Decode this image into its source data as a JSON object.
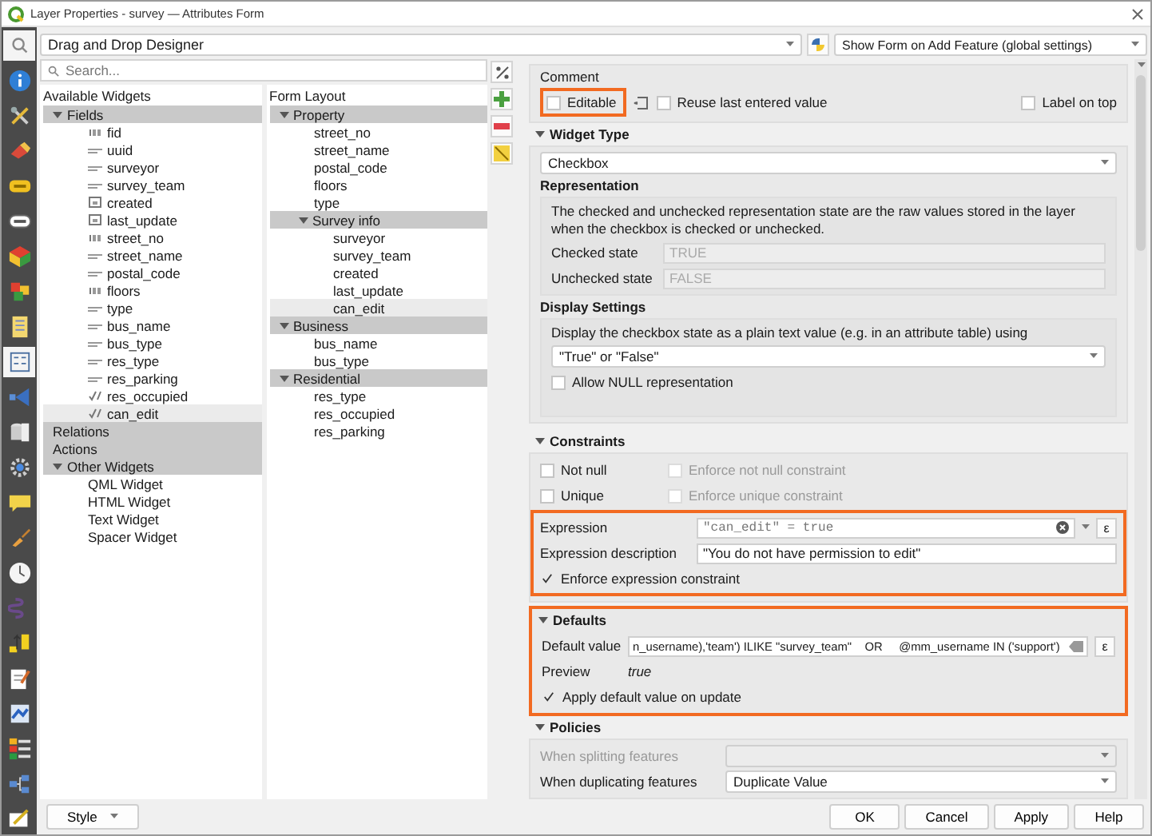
{
  "window": {
    "title": "Layer Properties - survey — Attributes Form"
  },
  "sidebar": {
    "items": [
      {
        "kind": "info",
        "selected": false
      },
      {
        "kind": "tools",
        "selected": false
      },
      {
        "kind": "paint",
        "selected": false
      },
      {
        "kind": "labels",
        "selected": false
      },
      {
        "kind": "masks",
        "selected": false
      },
      {
        "kind": "cube",
        "selected": false
      },
      {
        "kind": "blocks",
        "selected": false
      },
      {
        "kind": "fields",
        "selected": false
      },
      {
        "kind": "form",
        "selected": true
      },
      {
        "kind": "joins",
        "selected": false
      },
      {
        "kind": "storage",
        "selected": false
      },
      {
        "kind": "actions",
        "selected": false
      },
      {
        "kind": "bubble",
        "selected": false
      },
      {
        "kind": "brush",
        "selected": false
      },
      {
        "kind": "clock",
        "selected": false
      },
      {
        "kind": "variables",
        "selected": false
      },
      {
        "kind": "upload",
        "selected": false
      },
      {
        "kind": "notes",
        "selected": false
      },
      {
        "kind": "image",
        "selected": false
      },
      {
        "kind": "legend",
        "selected": false
      },
      {
        "kind": "network",
        "selected": false
      },
      {
        "kind": "digitize",
        "selected": false
      }
    ]
  },
  "toolbar": {
    "layout_mode": "Drag and Drop Designer",
    "suppress_mode": "Show Form on Add Feature (global settings)"
  },
  "search": {
    "placeholder": "Search..."
  },
  "available_widgets": {
    "title": "Available Widgets",
    "items": [
      {
        "label": "Fields",
        "kind": "group",
        "expanded": true,
        "selected": false,
        "children": [
          {
            "label": "fid",
            "kind": "integer",
            "selected": false
          },
          {
            "label": "uuid",
            "kind": "text",
            "selected": false
          },
          {
            "label": "surveyor",
            "kind": "text",
            "selected": false
          },
          {
            "label": "survey_team",
            "kind": "text",
            "selected": false
          },
          {
            "label": "created",
            "kind": "date",
            "selected": false
          },
          {
            "label": "last_update",
            "kind": "date",
            "selected": false
          },
          {
            "label": "street_no",
            "kind": "integer",
            "selected": false
          },
          {
            "label": "street_name",
            "kind": "text",
            "selected": false
          },
          {
            "label": "postal_code",
            "kind": "text",
            "selected": false
          },
          {
            "label": "floors",
            "kind": "integer",
            "selected": false
          },
          {
            "label": "type",
            "kind": "text",
            "selected": false
          },
          {
            "label": "bus_name",
            "kind": "text",
            "selected": false
          },
          {
            "label": "bus_type",
            "kind": "text",
            "selected": false
          },
          {
            "label": "res_type",
            "kind": "text",
            "selected": false
          },
          {
            "label": "res_parking",
            "kind": "text",
            "selected": false
          },
          {
            "label": "res_occupied",
            "kind": "boolean",
            "selected": false
          },
          {
            "label": "can_edit",
            "kind": "boolean",
            "selected": true
          }
        ]
      },
      {
        "label": "Relations",
        "kind": "group",
        "selected": false
      },
      {
        "label": "Actions",
        "kind": "group",
        "selected": false
      },
      {
        "label": "Other Widgets",
        "kind": "group",
        "expanded": true,
        "selected": false,
        "children": [
          {
            "label": "QML Widget",
            "selected": false
          },
          {
            "label": "HTML Widget",
            "selected": false
          },
          {
            "label": "Text Widget",
            "selected": false
          },
          {
            "label": "Spacer Widget",
            "selected": false
          }
        ]
      }
    ]
  },
  "form_layout": {
    "title": "Form Layout",
    "items": [
      {
        "label": "Property",
        "kind": "group",
        "expanded": true,
        "selected": false,
        "children": [
          {
            "label": "street_no",
            "selected": false
          },
          {
            "label": "street_name",
            "selected": false
          },
          {
            "label": "postal_code",
            "selected": false
          },
          {
            "label": "floors",
            "selected": false
          },
          {
            "label": "type",
            "selected": false
          },
          {
            "label": "Survey info",
            "kind": "group",
            "expanded": true,
            "selected": false,
            "children": [
              {
                "label": "surveyor",
                "selected": false
              },
              {
                "label": "survey_team",
                "selected": false
              },
              {
                "label": "created",
                "selected": false
              },
              {
                "label": "last_update",
                "selected": false
              },
              {
                "label": "can_edit",
                "selected": true
              }
            ]
          }
        ]
      },
      {
        "label": "Business",
        "kind": "group",
        "expanded": true,
        "selected": false,
        "children": [
          {
            "label": "bus_name",
            "selected": false
          },
          {
            "label": "bus_type",
            "selected": false
          }
        ]
      },
      {
        "label": "Residential",
        "kind": "group",
        "expanded": true,
        "selected": false,
        "children": [
          {
            "label": "res_type",
            "selected": false
          },
          {
            "label": "res_occupied",
            "selected": false
          },
          {
            "label": "res_parking",
            "selected": false
          }
        ]
      }
    ]
  },
  "general": {
    "comment_label": "Comment",
    "editable": {
      "label": "Editable",
      "checked": false,
      "highlighted": true
    },
    "reuse": {
      "label": "Reuse last entered value",
      "checked": false
    },
    "label_on_top": {
      "label": "Label on top",
      "checked": false
    }
  },
  "widget_type": {
    "title": "Widget Type",
    "expanded": true,
    "type": "Checkbox",
    "representation_title": "Representation",
    "representation_text": "The checked and unchecked representation state are the raw values stored in the layer when the checkbox is checked or unchecked.",
    "checked_state": {
      "label": "Checked state",
      "placeholder": "TRUE"
    },
    "unchecked_state": {
      "label": "Unchecked state",
      "placeholder": "FALSE"
    },
    "display_title": "Display Settings",
    "display_text": "Display the checkbox state as a plain text value (e.g. in an attribute table) using",
    "display_value": "\"True\" or \"False\"",
    "allow_null": {
      "label": "Allow NULL representation",
      "checked": false
    }
  },
  "constraints": {
    "title": "Constraints",
    "expanded": true,
    "not_null": {
      "label": "Not null",
      "checked": false
    },
    "enforce_not_null": {
      "label": "Enforce not null constraint",
      "checked": false,
      "disabled": true
    },
    "unique": {
      "label": "Unique",
      "checked": false
    },
    "enforce_unique": {
      "label": "Enforce unique constraint",
      "checked": false,
      "disabled": true
    },
    "expression_highlighted": true,
    "expression_label": "Expression",
    "expression": "\"can_edit\" = true",
    "expression_button": "ε",
    "description_label": "Expression description",
    "description": "\"You do not have permission to edit\"",
    "enforce_expression": {
      "label": "Enforce expression constraint",
      "checked": true
    }
  },
  "defaults": {
    "title": "Defaults",
    "expanded": true,
    "highlighted": true,
    "label": "Default value",
    "value": "n_username),'team') ILIKE \"survey_team\"    OR     @mm_username IN ('support')",
    "expression_button": "ε",
    "preview_label": "Preview",
    "preview": "true",
    "apply_on_update": {
      "label": "Apply default value on update",
      "checked": true
    }
  },
  "policies": {
    "title": "Policies",
    "expanded": true,
    "splitting": {
      "label": "When splitting features",
      "disabled": true
    },
    "duplicating": {
      "label": "When duplicating features",
      "value": "Duplicate Value",
      "disabled": false
    }
  },
  "footer": {
    "style_button": "Style",
    "buttons": [
      "OK",
      "Cancel",
      "Apply",
      "Help"
    ]
  }
}
